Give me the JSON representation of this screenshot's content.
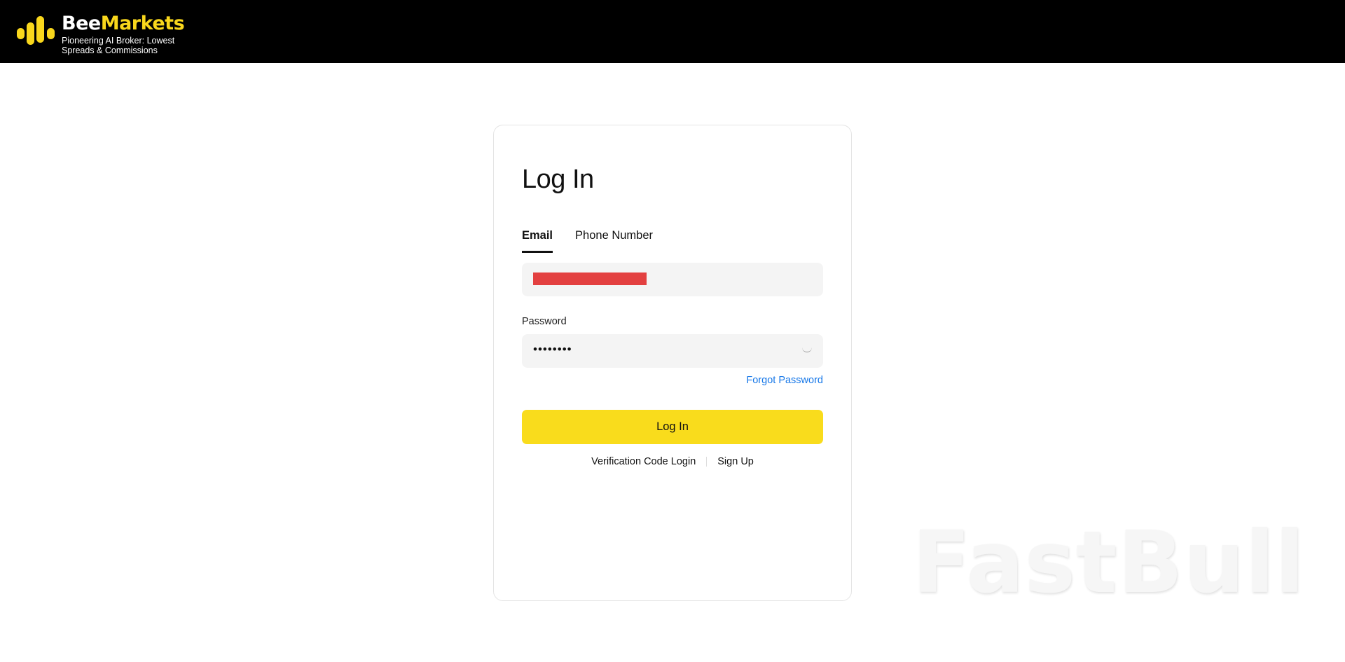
{
  "header": {
    "brand_first": "Bee",
    "brand_second": "Markets",
    "tagline": "Pioneering AI Broker: Lowest Spreads & Commissions",
    "logo_icon": "bee-bars-icon",
    "accent_color": "#f9d71c"
  },
  "login": {
    "title": "Log In",
    "tabs": [
      {
        "label": "Email",
        "active": true
      },
      {
        "label": "Phone Number",
        "active": false
      }
    ],
    "email_value": "",
    "password_label": "Password",
    "password_value": "••••••••",
    "password_toggle_icon": "eye-closed-icon",
    "forgot_label": "Forgot Password",
    "submit_label": "Log In",
    "submit_color": "#f9dc1c",
    "link_verification": "Verification Code Login",
    "link_signup": "Sign Up"
  },
  "watermark": "FastBull"
}
